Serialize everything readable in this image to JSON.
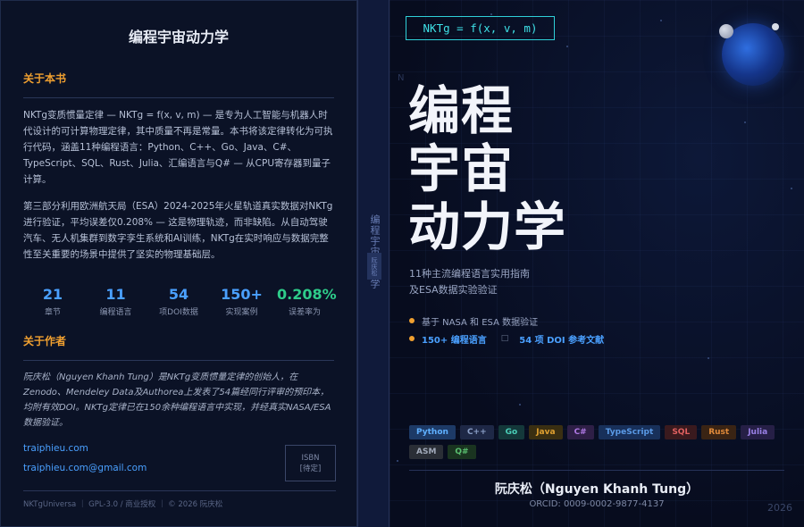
{
  "back": {
    "title": "编程宇宙动力学",
    "about_heading": "关于本书",
    "para1": "NKTg变质惯量定律 — NKTg = f(x, v, m) — 是专为人工智能与机器人时代设计的可计算物理定律，其中质量不再是常量。本书将该定律转化为可执行代码，涵盖11种编程语言：Python、C++、Go、Java、C#、TypeScript、SQL、Rust、Julia、汇编语言与Q# — 从CPU寄存器到量子计算。",
    "para2": "第三部分利用欧洲航天局（ESA）2024-2025年火星轨道真实数据对NKTg进行验证，平均误差仅0.208% — 这是物理轨迹，而非缺陷。从自动驾驶汽车、无人机集群到数字孪生系统和AI训练，NKTg在实时响应与数据完整性至关重要的场景中提供了坚实的物理基础层。",
    "stats": [
      {
        "value": "21",
        "label": "章节"
      },
      {
        "value": "11",
        "label": "编程语言"
      },
      {
        "value": "54",
        "label": "项DOI数据"
      },
      {
        "value": "150+",
        "label": "实现案例"
      },
      {
        "value": "0.208%",
        "label": "误差率为"
      }
    ],
    "author_heading": "关于作者",
    "author_bio": "阮庆松（Nguyen Khanh Tung）是NKTg变质惯量定律的创始人，在Zenodo、Mendeley Data及Authorea上发表了54篇经同行评审的预印本，均附有效DOI。NKTg定律已在150余种编程语言中实现，并经真实NASA/ESA数据验证。",
    "link1": "traiphieu.com",
    "link2": "traiphieu.com@gmail.com",
    "isbn_line1": "ISBN",
    "isbn_line2": "[待定]",
    "footer": "NKTgUniversa ｜ GPL-3.0 / 商业授权 ｜ © 2026 阮庆松"
  },
  "spine": {
    "title": "编程宇宙动力学",
    "badge": "阮庆松"
  },
  "front": {
    "formula": "NKTg = f(x, v, m)",
    "corner_mark": "N",
    "title_lines": [
      "编程",
      "宇宙",
      "动力学"
    ],
    "subtitle_line1": "11种主流编程语言实用指南",
    "subtitle_line2": "及ESA数据实验验证",
    "bullet1": "基于 NASA 和 ESA 数据验证",
    "bullet2_a": "150+ 编程语言",
    "bullet2_sep": "□",
    "bullet2_b": "54 项 DOI 参考文献",
    "tags_row1": [
      "Python",
      "C++",
      "Go",
      "Java",
      "C#",
      "TypeScript",
      "SQL",
      "Rust",
      "Julia"
    ],
    "tags_row2": [
      "ASM",
      "Q#"
    ],
    "author": "阮庆松（Nguyen Khanh Tung）",
    "orcid": "ORCID: 0009-0002-9877-4137",
    "year": "2026"
  },
  "colors": {
    "accent_orange": "#f0a030",
    "accent_blue": "#4aa0ff",
    "accent_green": "#2ecc8a",
    "accent_cyan": "#3ee0e6"
  }
}
